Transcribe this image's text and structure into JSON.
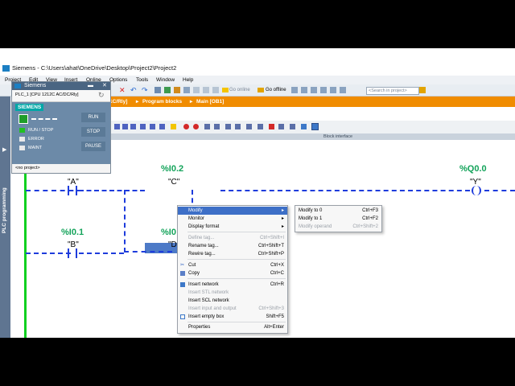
{
  "window": {
    "title": "Siemens - C:\\Users\\ahat\\OneDrive\\Desktop\\Project2\\Project2"
  },
  "menu": [
    "Project",
    "Edit",
    "View",
    "Insert",
    "Online",
    "Options",
    "Tools",
    "Window",
    "Help"
  ],
  "toolbar": {
    "go_online": "Go online",
    "go_offline": "Go offline",
    "search_placeholder": "<Search in project>"
  },
  "breadcrumb": {
    "device": "1C/Rly]",
    "sep1": "▸",
    "folder": "Program blocks",
    "sep2": "▸",
    "block": "Main [OB1]"
  },
  "sidebar": {
    "label": "PLC programming"
  },
  "block_interface": "Block interface",
  "plc_panel": {
    "title": "Siemens",
    "device": "PLC_1 [CPU 1212C AC/DC/Rly]",
    "brand": "SIEMENS",
    "run_stop": "RUN / STOP",
    "error": "ERROR",
    "maint": "MAINT",
    "btn_run": "RUN",
    "btn_stop": "STOP",
    "btn_pause": "PAUSE",
    "project": "<no project>",
    "colors": {
      "run_led": "#21c021",
      "error_led": "#e9e9e9",
      "maint_led": "#e9e9e9"
    }
  },
  "ladder": {
    "contacts": [
      {
        "addr": "",
        "tag": "\"A\""
      },
      {
        "addr": "%I0.2",
        "tag": "\"C\""
      },
      {
        "addr": "%I0.1",
        "tag": "\"B\""
      },
      {
        "addr": "%I0",
        "tag": "\"D"
      }
    ],
    "coil": {
      "addr": "%Q0.0",
      "tag": "\"Y\""
    },
    "colors": {
      "address": "#13a35a",
      "wire": "#1e3cdc",
      "rail": "#10d020"
    }
  },
  "context_menu": {
    "items": [
      {
        "label": "Modify",
        "shortcut": "",
        "submenu": true,
        "state": "highlighted"
      },
      {
        "label": "Monitor",
        "shortcut": "",
        "submenu": true,
        "state": "enabled"
      },
      {
        "label": "Display format",
        "shortcut": "",
        "submenu": true,
        "state": "enabled"
      },
      {
        "label": "Define tag...",
        "shortcut": "Ctrl+Shift+I",
        "state": "disabled"
      },
      {
        "label": "Rename tag...",
        "shortcut": "Ctrl+Shift+T",
        "state": "enabled"
      },
      {
        "label": "Rewire tag...",
        "shortcut": "Ctrl+Shift+P",
        "state": "enabled"
      },
      {
        "label": "Cut",
        "shortcut": "Ctrl+X",
        "state": "enabled"
      },
      {
        "label": "Copy",
        "shortcut": "Ctrl+C",
        "state": "enabled"
      },
      {
        "label": "Insert network",
        "shortcut": "Ctrl+R",
        "state": "enabled"
      },
      {
        "label": "Insert STL network",
        "shortcut": "",
        "state": "disabled"
      },
      {
        "label": "Insert SCL network",
        "shortcut": "",
        "state": "enabled"
      },
      {
        "label": "Insert input and output",
        "shortcut": "Ctrl+Shift+3",
        "state": "disabled"
      },
      {
        "label": "Insert empty box",
        "shortcut": "Shift+F5",
        "state": "enabled"
      },
      {
        "label": "Properties",
        "shortcut": "Alt+Enter",
        "state": "enabled"
      }
    ]
  },
  "submenu": {
    "items": [
      {
        "label": "Modify to 0",
        "shortcut": "Ctrl+F3",
        "state": "enabled"
      },
      {
        "label": "Modify to 1",
        "shortcut": "Ctrl+F2",
        "state": "enabled"
      },
      {
        "label": "Modify operand",
        "shortcut": "Ctrl+Shift+2",
        "state": "disabled"
      }
    ]
  }
}
